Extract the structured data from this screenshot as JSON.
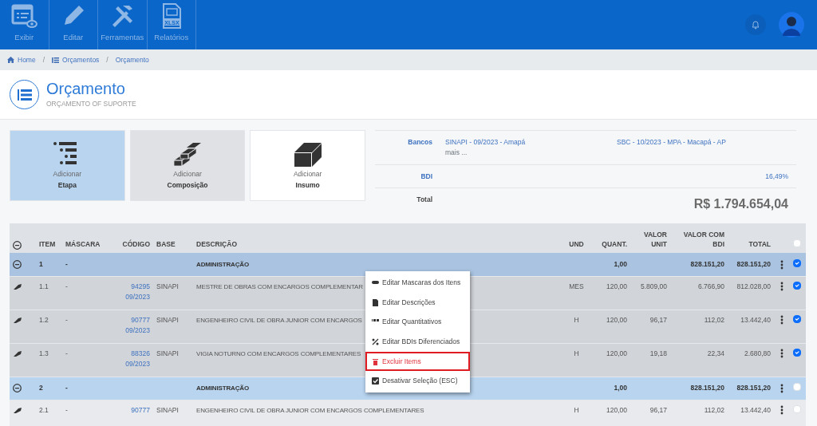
{
  "toolbar": [
    {
      "label": "Exibir",
      "kind": "view"
    },
    {
      "label": "Editar",
      "kind": "edit"
    },
    {
      "label": "Ferramentas",
      "kind": "tools"
    },
    {
      "label": "Relatórios",
      "kind": "xlsx",
      "badge": "XLSX"
    }
  ],
  "breadcrumb": [
    {
      "label": "Home",
      "kind": "home"
    },
    {
      "separator": "/",
      "label": "Orçamentos",
      "kind": "list"
    },
    {
      "separator": "/",
      "label": "Orçamento",
      "kind": "plain"
    }
  ],
  "header": {
    "title": "Orçamento",
    "subtitle": "ORÇAMENTO OF SUPORTE"
  },
  "actions": [
    {
      "caption": "Adicionar",
      "label": "Etapa",
      "kind": "steps",
      "selected": true,
      "hovered": false
    },
    {
      "caption": "Adicionar",
      "label": "Composição",
      "kind": "bricks",
      "selected": false,
      "hovered": true
    },
    {
      "caption": "Adicionar",
      "label": "Insumo",
      "kind": "block",
      "selected": false,
      "hovered": false
    }
  ],
  "summary": {
    "banks_label": "Bancos",
    "banks": [
      "SINAPI - 09/2023 - Amapá",
      "SBC - 10/2023 - MPA - Macapá - AP"
    ],
    "more": "mais ...",
    "bdi_label": "BDI",
    "bdi": "16,49%",
    "total_label": "Total",
    "total": "R$ 1.794.654,04"
  },
  "table": {
    "columns": [
      "ITEM",
      "MÁSCARA",
      "CÓDIGO",
      "BASE",
      "DESCRIÇÃO",
      "UND",
      "QUANT.",
      "VALOR UNIT",
      "VALOR COM BDI",
      "TOTAL"
    ],
    "all_checked": false,
    "rows": [
      {
        "kind": "group",
        "item": "1",
        "mask": "-",
        "description": "ADMINISTRAÇÃO",
        "quant": "1,00",
        "bdi_value": "828.151,20",
        "total": "828.151,20",
        "checked": true
      },
      {
        "kind": "item",
        "item": "1.1",
        "mask": "-",
        "code": "94295",
        "code_date": "09/2023",
        "base": "SINAPI",
        "description": "MESTRE DE OBRAS COM ENCARGOS COMPLEMENTAR",
        "unit": "MES",
        "quant": "120,00",
        "unit_value": "5.809,00",
        "bdi_value": "6.766,90",
        "total": "812.028,00",
        "checked": true
      },
      {
        "kind": "item",
        "item": "1.2",
        "mask": "-",
        "code": "90777",
        "code_date": "09/2023",
        "base": "SINAPI",
        "description": "ENGENHEIRO CIVIL DE OBRA JUNIOR COM ENCARGOS",
        "unit": "H",
        "quant": "120,00",
        "unit_value": "96,17",
        "bdi_value": "112,02",
        "total": "13.442,40",
        "checked": true
      },
      {
        "kind": "item",
        "item": "1.3",
        "mask": "-",
        "code": "88326",
        "code_date": "09/2023",
        "base": "SINAPI",
        "description": "VIGIA NOTURNO COM ENCARGOS COMPLEMENTARES",
        "unit": "H",
        "quant": "120,00",
        "unit_value": "19,18",
        "bdi_value": "22,34",
        "total": "2.680,80",
        "checked": true
      },
      {
        "kind": "group",
        "item": "2",
        "mask": "-",
        "description": "ADMINISTRAÇÃO",
        "quant": "1,00",
        "bdi_value": "828.151,20",
        "total": "828.151,20",
        "checked": false
      },
      {
        "kind": "item",
        "item": "2.1",
        "mask": "-",
        "code": "90777",
        "base": "SINAPI",
        "description": "ENGENHEIRO CIVIL DE OBRA JUNIOR COM ENCARGOS COMPLEMENTARES",
        "unit": "H",
        "quant": "120,00",
        "unit_value": "96,17",
        "bdi_value": "112,02",
        "total": "13.442,40",
        "checked": false
      }
    ]
  },
  "context_menu": [
    {
      "label": "Editar Mascaras dos Itens",
      "kind": "mask",
      "highlighted": false
    },
    {
      "label": "Editar Descrições",
      "kind": "doc",
      "highlighted": false
    },
    {
      "label": "Editar Quantitativos",
      "kind": "numbers",
      "highlighted": false
    },
    {
      "label": "Editar BDIs Diferenciados",
      "kind": "percent",
      "highlighted": false
    },
    {
      "label": "Excluir Items",
      "kind": "trash",
      "highlighted": true
    },
    {
      "label": "Desativar Seleção (ESC)",
      "kind": "check",
      "highlighted": false
    }
  ]
}
